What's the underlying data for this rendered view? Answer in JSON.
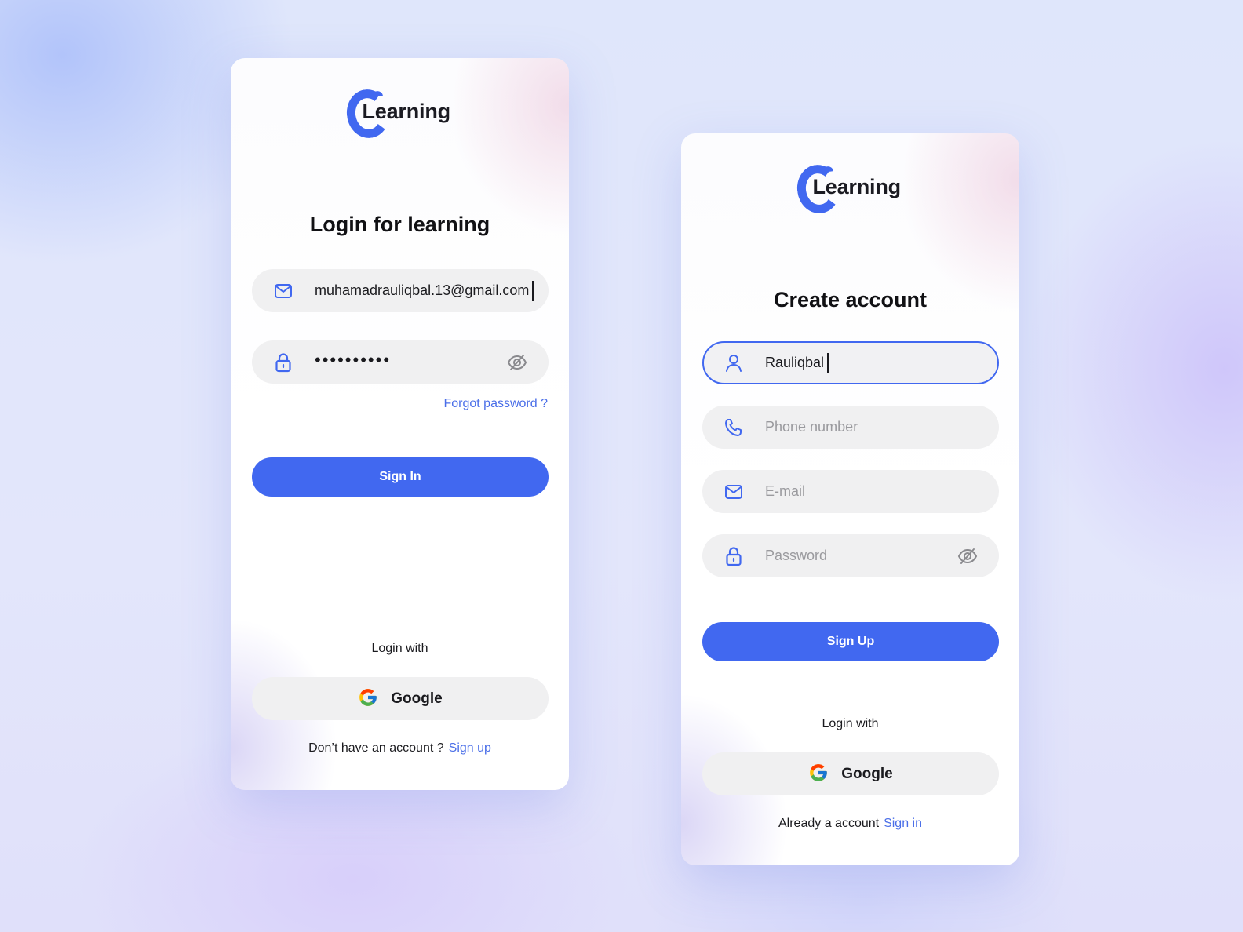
{
  "colors": {
    "accent": "#4168f0",
    "link": "#4a6ee8",
    "field_bg": "#f0f0f1",
    "placeholder": "#9a9a9e",
    "text": "#1a1a1e"
  },
  "login_card": {
    "brand": "Learning",
    "title": "Login for learning",
    "email_field": {
      "icon": "mail-icon",
      "value": "muhamadrauliqbal.13@gmail.com"
    },
    "password_field": {
      "icon": "lock-icon",
      "value_masked": "••••••••••",
      "toggle_icon": "eye-off-icon"
    },
    "forgot_password": "Forgot password ?",
    "sign_in_button": "Sign In",
    "login_with": "Login with",
    "google_button": "Google",
    "footer_text": "Don’t have an account ?",
    "footer_link": "Sign up"
  },
  "signup_card": {
    "brand": "Learning",
    "title": "Create account",
    "name_field": {
      "icon": "user-icon",
      "value": "Rauliqbal"
    },
    "phone_field": {
      "icon": "phone-icon",
      "placeholder": "Phone number"
    },
    "email_field": {
      "icon": "mail-icon",
      "placeholder": "E-mail"
    },
    "password_field": {
      "icon": "lock-icon",
      "placeholder": "Password",
      "toggle_icon": "eye-off-icon"
    },
    "sign_up_button": "Sign Up",
    "login_with": "Login with",
    "google_button": "Google",
    "footer_text": "Already a account",
    "footer_link": "Sign in"
  }
}
